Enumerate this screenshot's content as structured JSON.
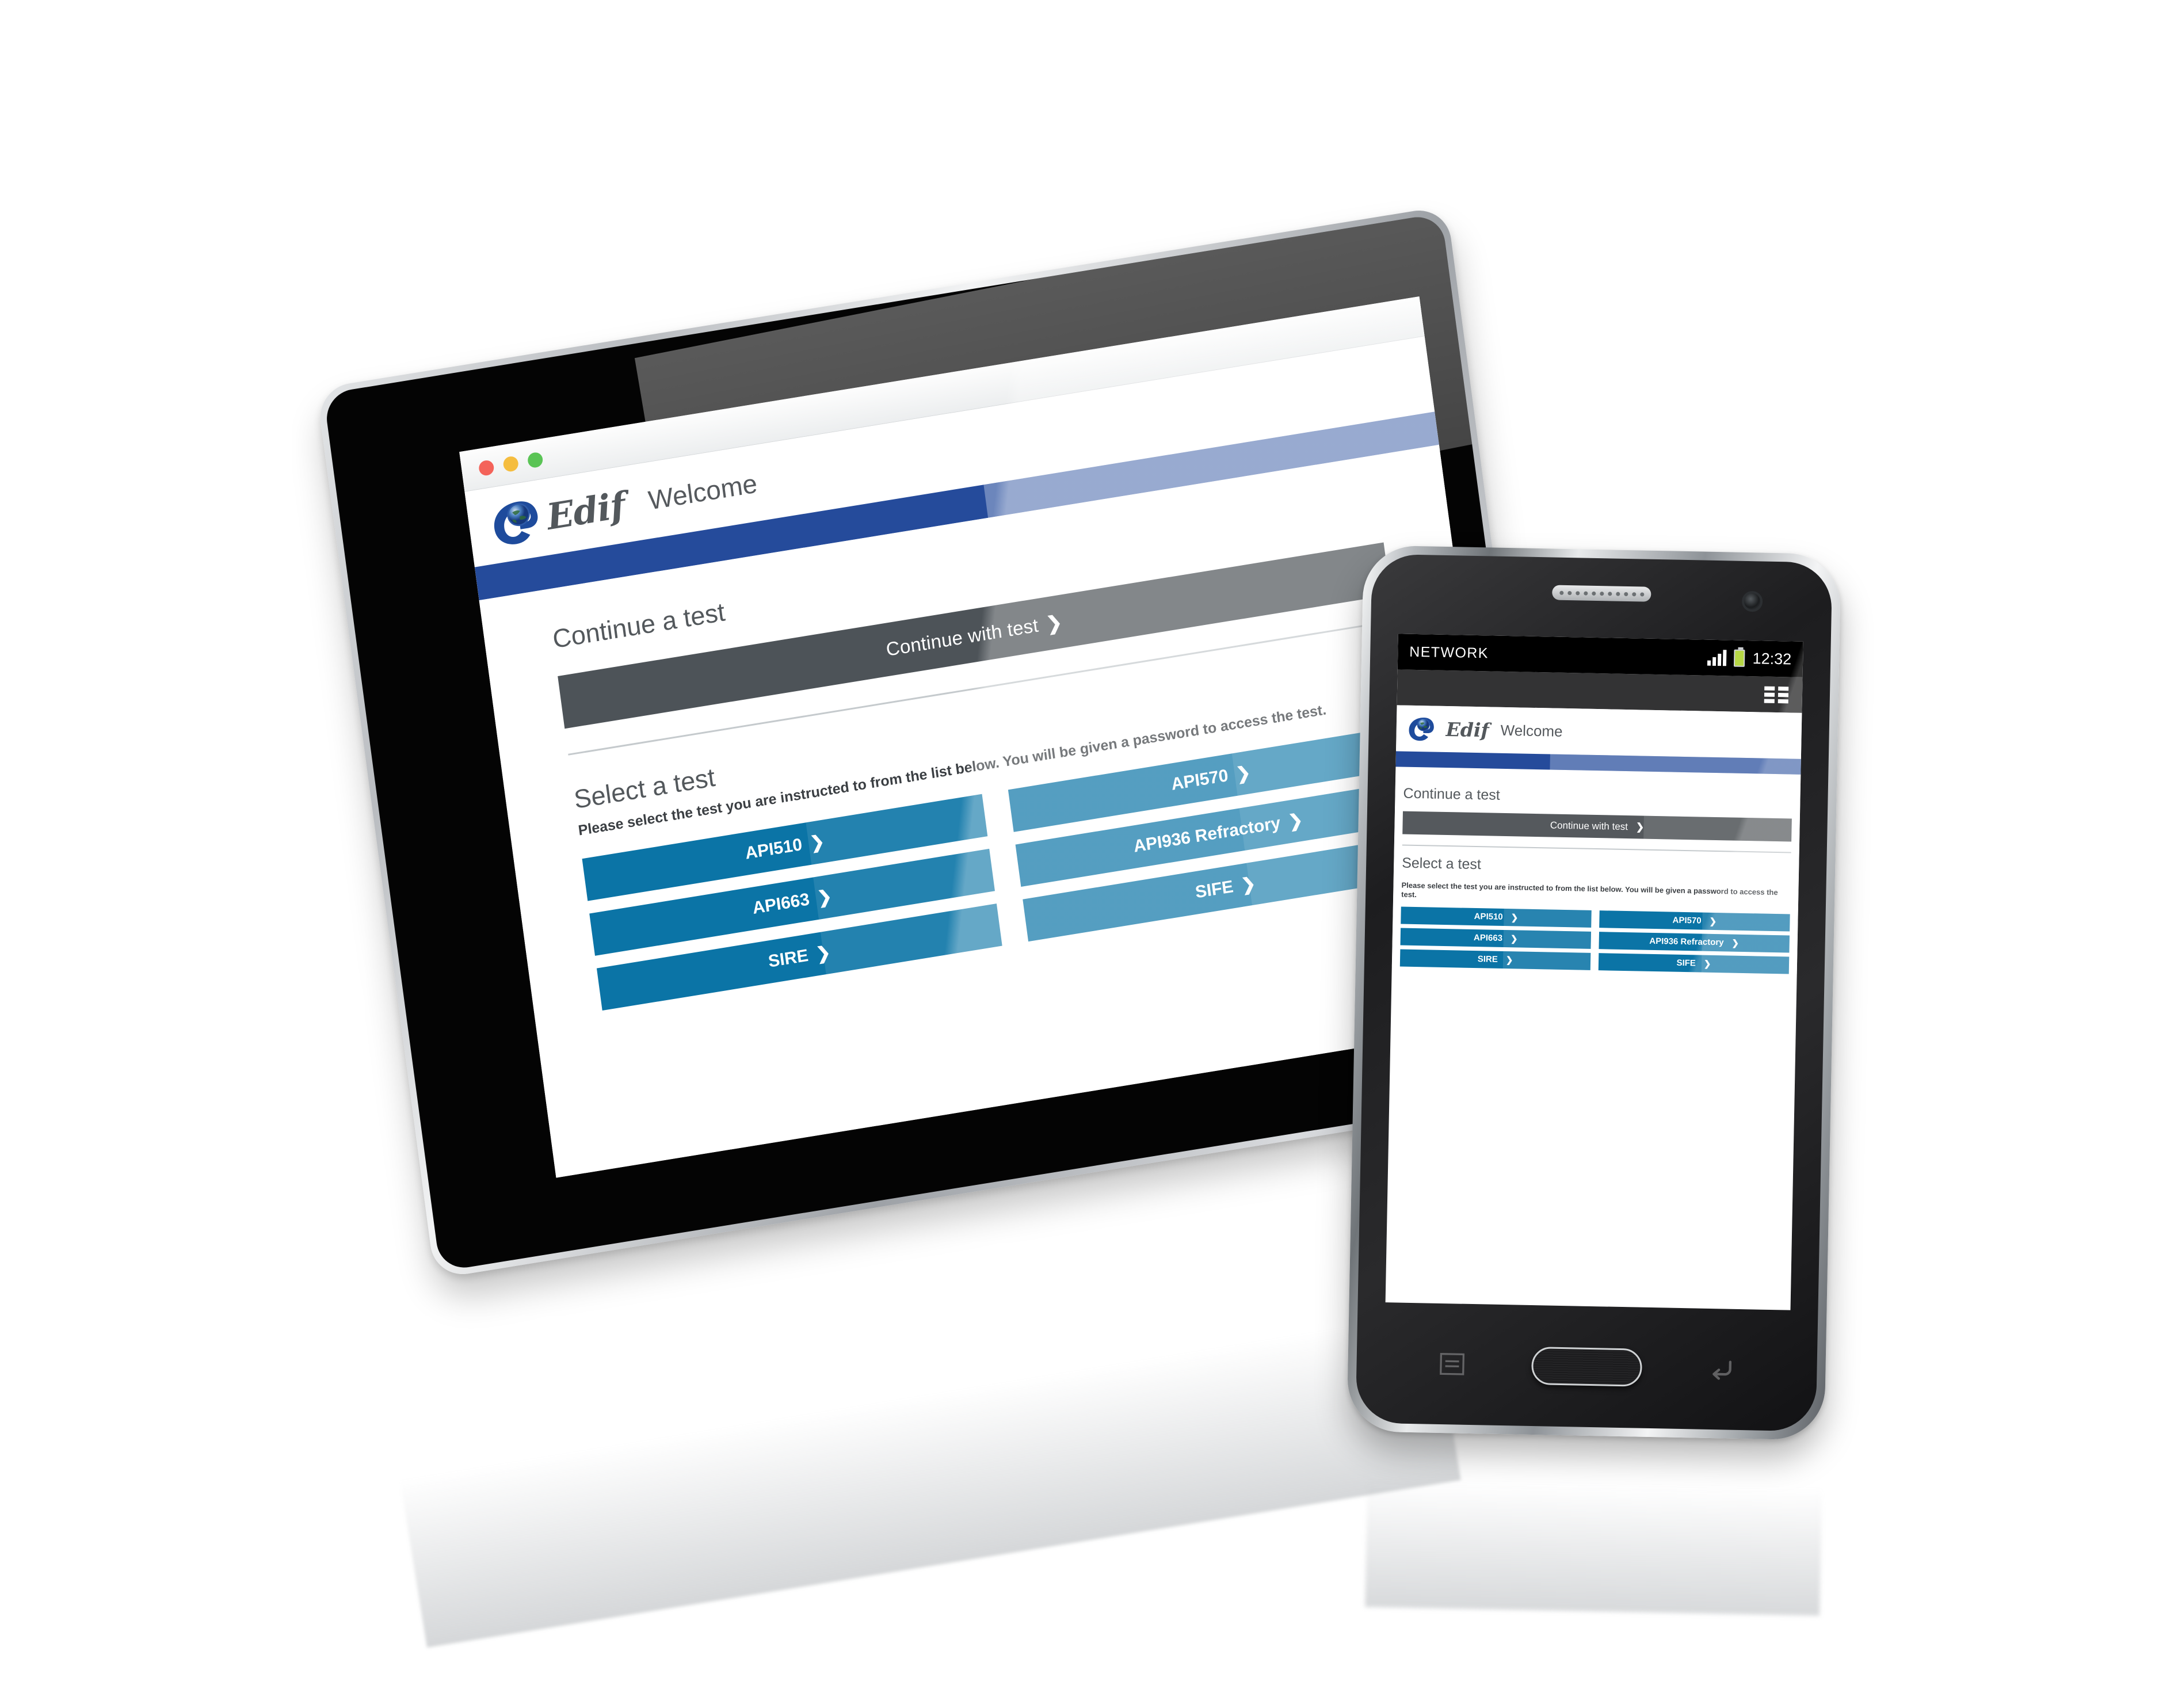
{
  "brand": {
    "name": "Edif",
    "logo_icon": "edif-globe-e-logo",
    "blue": "#254b9b",
    "accent_blue": "#0b74a6",
    "dark_gray": "#4d5358"
  },
  "tablet": {
    "browser": {
      "traffic_lights": [
        "close-red",
        "minimize-yellow",
        "zoom-green"
      ]
    },
    "header": {
      "logo_text": "Edif",
      "page_title": "Welcome"
    },
    "continue_section": {
      "heading": "Continue a test",
      "button_label": "Continue with test",
      "chevron": "❯"
    },
    "select_section": {
      "heading": "Select a test",
      "intro": "Please select the test you are instructed to from the list below. You will be given a password to access the test.",
      "tests": [
        {
          "label": "API510"
        },
        {
          "label": "API570"
        },
        {
          "label": "API663"
        },
        {
          "label": "API936 Refractory"
        },
        {
          "label": "SIRE"
        },
        {
          "label": "SIFE"
        }
      ]
    }
  },
  "phone": {
    "status_bar": {
      "carrier": "NETWORK",
      "signal_icon": "signal-bars-icon",
      "battery_icon": "battery-icon",
      "time": "12:32"
    },
    "action_bar": {
      "menu_icon": "grid-menu-icon"
    },
    "header": {
      "logo_text": "Edif",
      "page_title": "Welcome"
    },
    "continue_section": {
      "heading": "Continue a test",
      "button_label": "Continue with test",
      "chevron": "❯"
    },
    "select_section": {
      "heading": "Select a test",
      "intro": "Please select the test you are instructed to from the list below. You will be given a password to access the test.",
      "tests": [
        {
          "label": "API510"
        },
        {
          "label": "API570"
        },
        {
          "label": "API663"
        },
        {
          "label": "API936 Refractory"
        },
        {
          "label": "SIRE"
        },
        {
          "label": "SIFE"
        }
      ]
    },
    "hardware": {
      "menu_button_icon": "menu-soft-key-icon",
      "home_button_icon": "home-button",
      "back_button_icon": "back-soft-key-icon",
      "speaker_icon": "earpiece-speaker",
      "camera_icon": "front-camera-lens"
    }
  }
}
